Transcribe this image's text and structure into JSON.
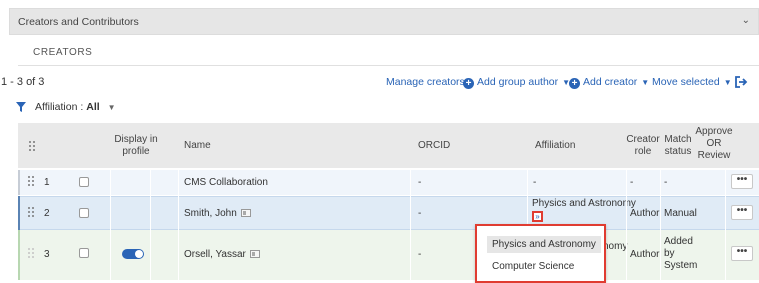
{
  "section": {
    "title": "Creators and Contributors"
  },
  "tab": {
    "label": "CREATORS"
  },
  "toolbar": {
    "count": "1 - 3 of 3",
    "manage": "Manage creators",
    "add_group": "Add group author",
    "add_creator": "Add creator",
    "move_selected": "Move selected"
  },
  "filter": {
    "label": "Affiliation :",
    "value": "All"
  },
  "columns": {
    "display_line1": "Display in",
    "display_line2": "profile",
    "name": "Name",
    "orcid": "ORCID",
    "affiliation": "Affiliation",
    "role_line1": "Creator",
    "role_line2": "role",
    "match_line1": "Match",
    "match_line2": "status",
    "approve_line1": "Approve",
    "approve_line2": "OR",
    "approve_line3": "Review"
  },
  "rows": [
    {
      "num": "1",
      "name": "CMS Collaboration",
      "orcid": "-",
      "affiliation": "-",
      "role": "-",
      "match": "-",
      "display_on": false
    },
    {
      "num": "2",
      "name": "Smith, John",
      "orcid": "-",
      "affiliation": "Physics and Astronomy",
      "role": "Author",
      "match": "Manual",
      "display_on": false
    },
    {
      "num": "3",
      "name": "Orsell, Yassar",
      "orcid": "-",
      "affiliation_tail": "nomy",
      "role": "Author",
      "match_line1": "Added",
      "match_line2": "by",
      "match_line3": "System",
      "display_on": true
    }
  ],
  "row_action_label": "•••",
  "affiliation_dropdown": {
    "options": [
      "Physics and Astronomy",
      "Computer Science"
    ],
    "highlighted": "Physics and Astronomy"
  },
  "colors": {
    "accent": "#2a64b6",
    "highlight": "#e03c31"
  },
  "icons": [
    "chevron-down-icon",
    "plus-circle-icon",
    "export-icon",
    "filter-icon",
    "drag-handle-icon",
    "id-card-icon",
    "expand-icon"
  ]
}
